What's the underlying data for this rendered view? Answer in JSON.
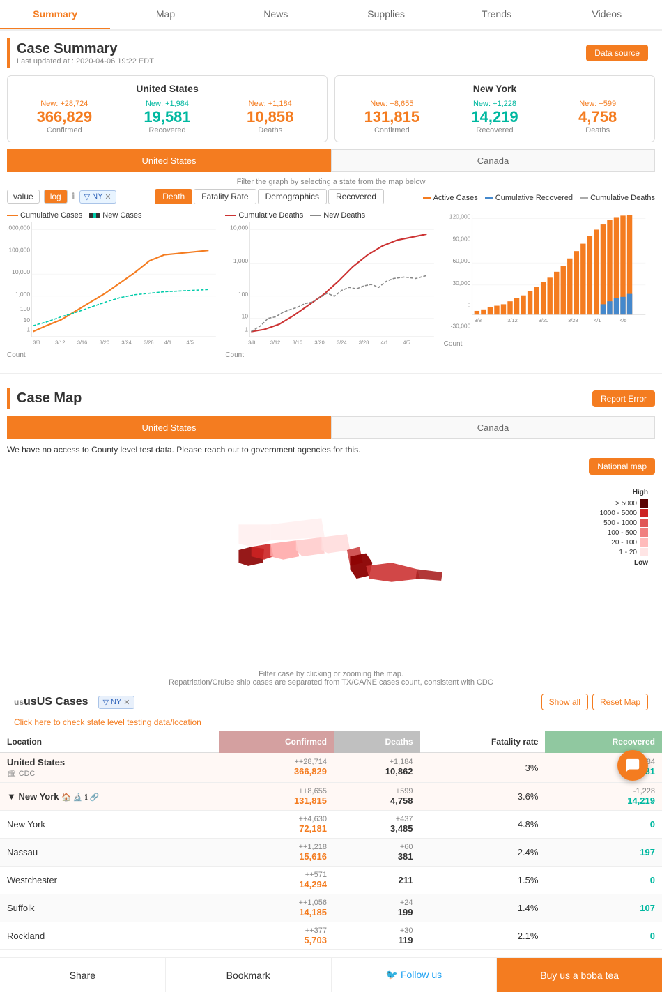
{
  "nav": {
    "items": [
      "Summary",
      "Map",
      "News",
      "Supplies",
      "Trends",
      "Videos"
    ],
    "active": "Summary"
  },
  "header": {
    "title": "Case Summary",
    "updated": "Last updated at : 2020-04-06 19:22 EDT",
    "data_source": "Data source"
  },
  "us_stats": {
    "title": "United States",
    "confirmed_new": "New: +28,724",
    "confirmed": "366,829",
    "confirmed_label": "Confirmed",
    "recovered_new": "New: +1,984",
    "recovered": "19,581",
    "recovered_label": "Recovered",
    "deaths_new": "New: +1,184",
    "deaths": "10,858",
    "deaths_label": "Deaths"
  },
  "ny_stats": {
    "title": "New York",
    "confirmed_new": "New: +8,655",
    "confirmed": "131,815",
    "confirmed_label": "Confirmed",
    "recovered_new": "New: +1,228",
    "recovered": "14,219",
    "recovered_label": "Recovered",
    "deaths_new": "New: +599",
    "deaths": "4,758",
    "deaths_label": "Deaths"
  },
  "toggles": {
    "us_label": "United States",
    "canada_label": "Canada"
  },
  "chart_controls": {
    "value_label": "value",
    "log_label": "log",
    "ny_tag": "NY",
    "filter_note": "Filter the graph by selecting a state from the map below"
  },
  "death_tabs": {
    "tabs": [
      "Death",
      "Fatality Rate",
      "Demographics",
      "Recovered"
    ],
    "active": "Death"
  },
  "chart1_legend": {
    "cumulative": "Cumulative Cases",
    "new_cases": "New Cases"
  },
  "chart2_legend": {
    "cumulative": "Cumulative Deaths",
    "new_deaths": "New Deaths"
  },
  "chart3_legend": {
    "active": "Active Cases",
    "cumulative_recovered": "Cumulative Recovered",
    "cumulative_deaths": "Cumulative Deaths"
  },
  "case_map": {
    "title": "Case Map",
    "report_error": "Report Error",
    "us_label": "United States",
    "canada_label": "Canada",
    "no_county": "We have no access to County level test data. Please reach out to government agencies for this.",
    "national_map": "National map",
    "filter_note1": "Filter case by clicking or zooming the map.",
    "filter_note2": "Repatriation/Cruise ship cases are separated from TX/CA/NE cases count, consistent with CDC"
  },
  "map_legend": {
    "high": "High",
    "gt5000": "> 5000",
    "k1_5k": "1000 - 5000",
    "h5_1k": "500 - 1000",
    "h1_500": "100 - 500",
    "t20_100": "20 - 100",
    "t1_20": "1 - 20",
    "low": "Low"
  },
  "table": {
    "title": "usUS Cases",
    "ny_tag": "NY",
    "show_all": "Show all",
    "reset_map": "Reset Map",
    "test_link": "Click here to check state level testing data/location",
    "headers": {
      "location": "Location",
      "confirmed": "Confirmed",
      "deaths": "Deaths",
      "fatality": "Fatality rate",
      "recovered": "Recovered"
    },
    "rows": [
      {
        "location": "United States",
        "sublabel": "CDC",
        "confirmed_new": "+28,714",
        "confirmed": "366,829",
        "deaths_new": "+1,184",
        "deaths": "10,862",
        "fatality": "3%",
        "recovered_new": "-1,984",
        "recovered": "19,581"
      },
      {
        "location": "New York",
        "icons": true,
        "confirmed_new": "+8,655",
        "confirmed": "131,815",
        "deaths_new": "+599",
        "deaths": "4,758",
        "fatality": "3.6%",
        "recovered_new": "-1,228",
        "recovered": "14,219"
      },
      {
        "location": "New York",
        "confirmed_new": "+4,630",
        "confirmed": "72,181",
        "deaths_new": "+437",
        "deaths": "3,485",
        "fatality": "4.8%",
        "recovered": "0"
      },
      {
        "location": "Nassau",
        "confirmed_new": "+1,218",
        "confirmed": "15,616",
        "deaths_new": "+60",
        "deaths": "381",
        "fatality": "2.4%",
        "recovered": "197"
      },
      {
        "location": "Westchester",
        "confirmed_new": "+571",
        "confirmed": "14,294",
        "deaths_new": "",
        "deaths": "211",
        "fatality": "1.5%",
        "recovered": "0"
      },
      {
        "location": "Suffolk",
        "confirmed_new": "+1,056",
        "confirmed": "14,185",
        "deaths_new": "+24",
        "deaths": "199",
        "fatality": "1.4%",
        "recovered": "107"
      },
      {
        "location": "Rockland",
        "confirmed_new": "+377",
        "confirmed": "5,703",
        "deaths_new": "+30",
        "deaths": "119",
        "fatality": "2.1%",
        "recovered": "0"
      }
    ]
  },
  "footer": {
    "share": "Share",
    "bookmark": "Bookmark",
    "follow": "Follow us",
    "boba": "Buy us a boba tea"
  }
}
